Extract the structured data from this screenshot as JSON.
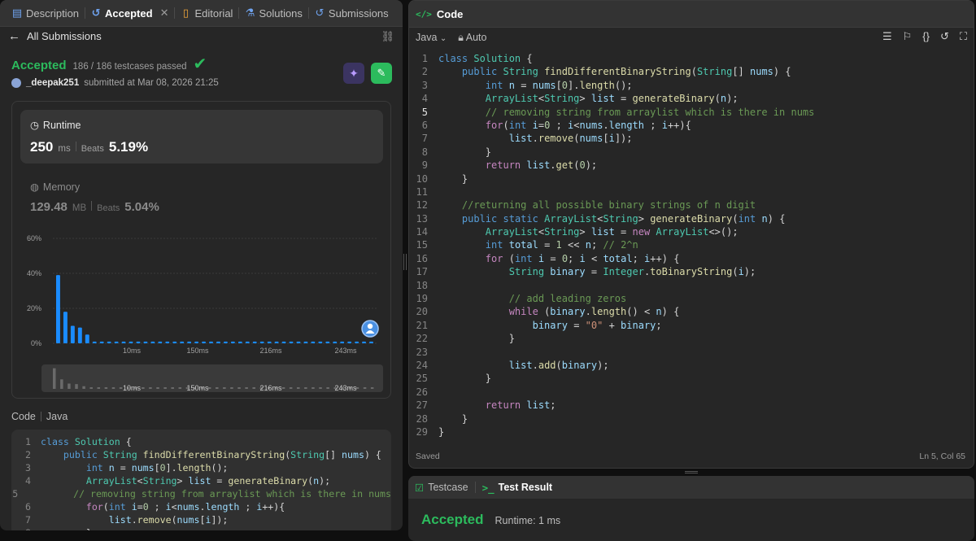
{
  "left": {
    "tabs": [
      {
        "label": "Description",
        "icon": "description-icon"
      },
      {
        "label": "Accepted",
        "icon": "history-icon"
      },
      {
        "label": "Editorial",
        "icon": "book-icon"
      },
      {
        "label": "Solutions",
        "icon": "flask-icon"
      },
      {
        "label": "Submissions",
        "icon": "history-icon"
      }
    ],
    "back_label": "All Submissions",
    "status": "Accepted",
    "testcases": "186 / 186 testcases passed",
    "submitter": "_deepak251",
    "submitted_at": "submitted at Mar 08, 2026 21:25",
    "runtime": {
      "label": "Runtime",
      "value": "250",
      "unit": "ms",
      "beats_label": "Beats",
      "beats": "5.19%"
    },
    "memory": {
      "label": "Memory",
      "value": "129.48",
      "unit": "MB",
      "beats_label": "Beats",
      "beats": "5.04%"
    },
    "code_label": "Code",
    "code_lang": "Java"
  },
  "chart_data": {
    "type": "bar",
    "yticks": [
      "60%",
      "40%",
      "20%",
      "0%"
    ],
    "ylim": [
      0,
      60
    ],
    "xticks": [
      "10ms",
      "150ms",
      "216ms",
      "243ms"
    ],
    "values": [
      39,
      18,
      10,
      9,
      5,
      1,
      1,
      1,
      1,
      1,
      1,
      1,
      1,
      1,
      1,
      1,
      1,
      1,
      1,
      1,
      1,
      1,
      1,
      1,
      1,
      1,
      1,
      1,
      1,
      1,
      1,
      1,
      1,
      1,
      1,
      1,
      1,
      1,
      1,
      1,
      1,
      1,
      1,
      1
    ],
    "highlight_index": 43,
    "overview_xticks": [
      "10ms",
      "150ms",
      "216ms",
      "243ms"
    ]
  },
  "right": {
    "title": "Code",
    "language": "Java",
    "mode": "Auto",
    "status": "Saved",
    "cursor": "Ln 5, Col 65"
  },
  "bottom": {
    "tabs": [
      "Testcase",
      "Test Result"
    ],
    "result": "Accepted",
    "runtime": "Runtime: 1 ms"
  },
  "code_lines": [
    "class Solution {",
    "    public String findDifferentBinaryString(String[] nums) {",
    "        int n = nums[0].length();",
    "        ArrayList<String> list = generateBinary(n);",
    "        // removing string from arraylist which is there in nums",
    "        for(int i=0 ; i<nums.length ; i++){",
    "            list.remove(nums[i]);",
    "        }",
    "        return list.get(0);",
    "    }",
    "",
    "    //returning all possible binary strings of n digit",
    "    public static ArrayList<String> generateBinary(int n) {",
    "        ArrayList<String> list = new ArrayList<>();",
    "        int total = 1 << n; // 2^n",
    "        for (int i = 0; i < total; i++) {",
    "            String binary = Integer.toBinaryString(i);",
    "",
    "            // add leading zeros",
    "            while (binary.length() < n) {",
    "                binary = \"0\" + binary;",
    "            }",
    "",
    "            list.add(binary);",
    "        }",
    "",
    "        return list;",
    "    }",
    "}"
  ]
}
